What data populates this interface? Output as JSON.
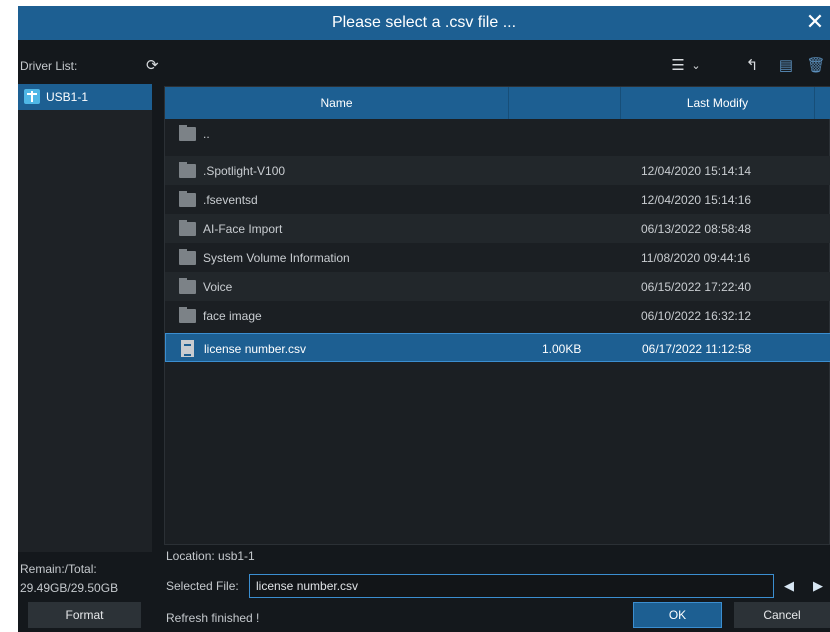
{
  "dialog": {
    "title": "Please select a .csv file ...",
    "close_glyph": "✕"
  },
  "drivers": {
    "label": "Driver List:",
    "refresh_icon": "refresh-icon",
    "items": [
      {
        "name": "USB1-1",
        "icon": "usb-icon"
      }
    ]
  },
  "storage": {
    "remain_label": "Remain:/Total:",
    "remain_value": "29.49GB/29.50GB"
  },
  "format_label": "Format",
  "toolbar": {
    "icons": [
      "list-view-icon",
      "chevron-down-icon",
      "back-icon",
      "new-folder-icon",
      "delete-icon"
    ],
    "glyphs": {
      "view": "☰",
      "dropdown": "⌄",
      "back": "↰",
      "newfolder": "▤",
      "delete": "🗑"
    }
  },
  "columns": {
    "name": "Name",
    "size": "",
    "last_modify": "Last Modify"
  },
  "files": [
    {
      "type": "folder",
      "name": "..",
      "size": "",
      "date": ""
    },
    {
      "type": "folder",
      "name": ".Spotlight-V100",
      "size": "",
      "date": "12/04/2020 15:14:14"
    },
    {
      "type": "folder",
      "name": ".fseventsd",
      "size": "",
      "date": "12/04/2020 15:14:16"
    },
    {
      "type": "folder",
      "name": "AI-Face Import",
      "size": "",
      "date": "06/13/2022 08:58:48"
    },
    {
      "type": "folder",
      "name": "System Volume Information",
      "size": "",
      "date": "11/08/2020 09:44:16"
    },
    {
      "type": "folder",
      "name": "Voice",
      "size": "",
      "date": "06/15/2022 17:22:40"
    },
    {
      "type": "folder",
      "name": "face image",
      "size": "",
      "date": "06/10/2022 16:32:12"
    },
    {
      "type": "file",
      "name": "license number.csv",
      "size": "1.00KB",
      "date": "06/17/2022 11:12:58",
      "selected": true
    }
  ],
  "location": "Location: usb1-1",
  "selected_file": {
    "label": "Selected File:",
    "value": "license number.csv"
  },
  "nav": {
    "prev": "◀",
    "next": "▶"
  },
  "status": "Refresh finished !",
  "buttons": {
    "ok": "OK",
    "cancel": "Cancel"
  },
  "colors": {
    "accent": "#1d5f92",
    "background": "#14181c",
    "selection_border": "#3b8ed0"
  }
}
